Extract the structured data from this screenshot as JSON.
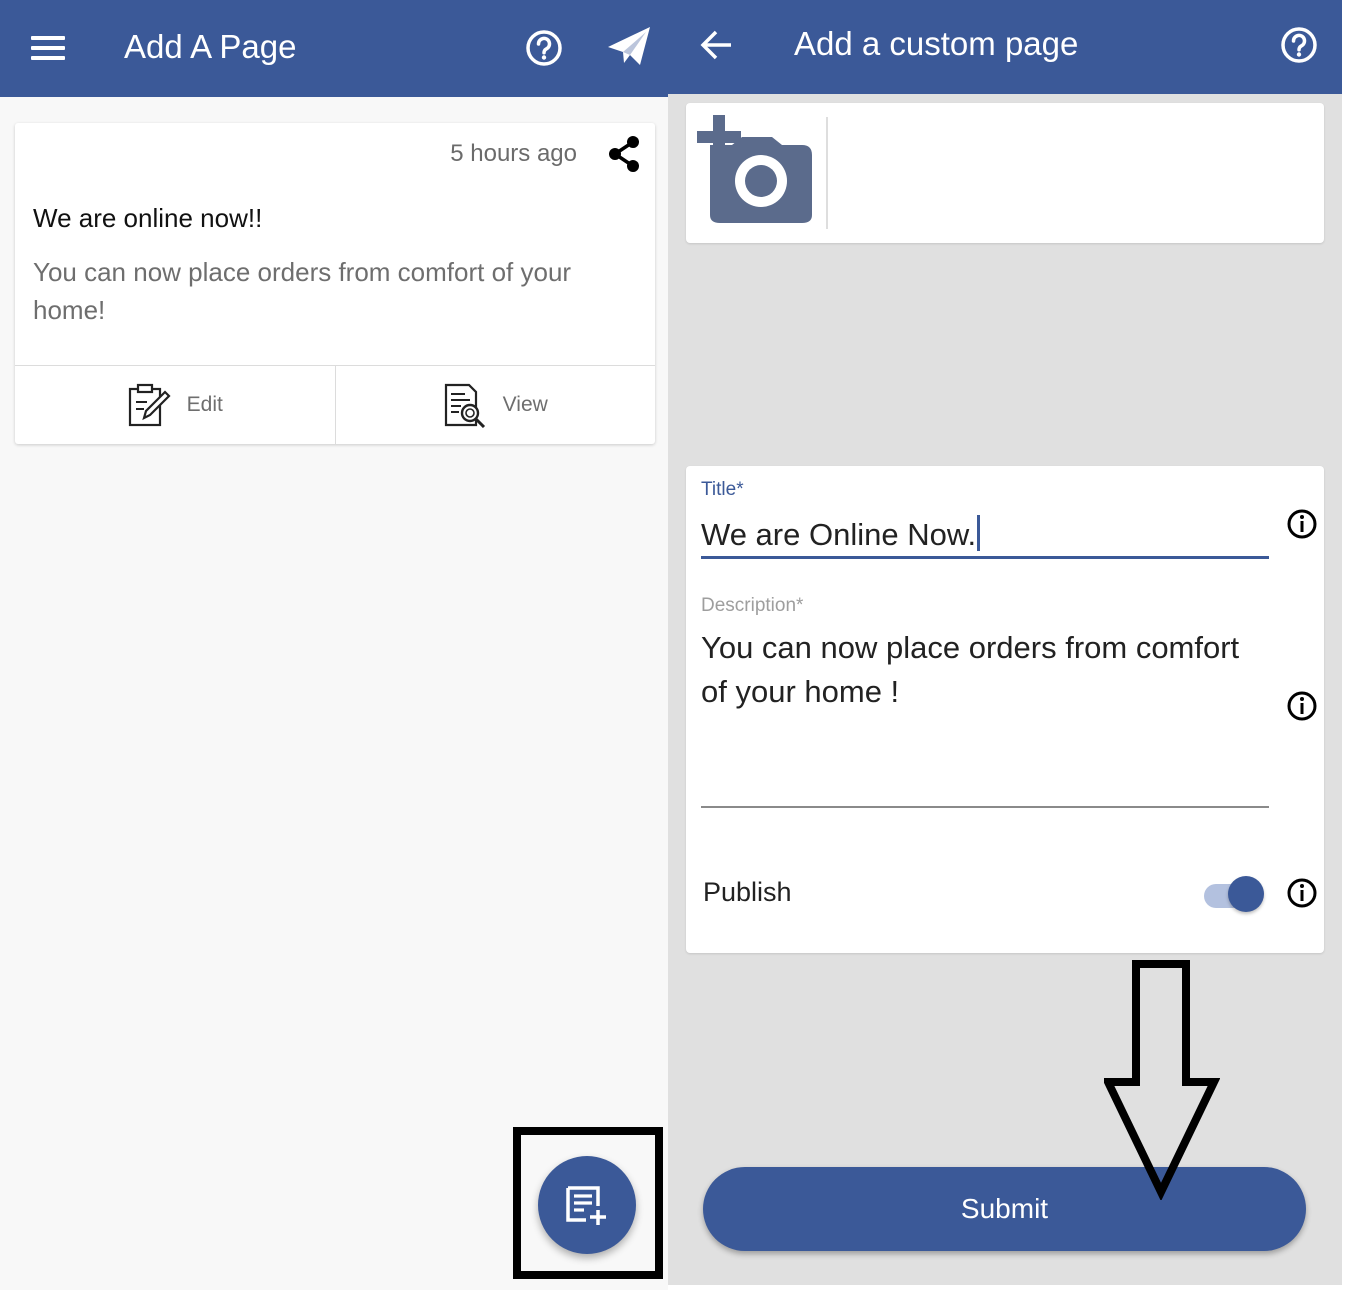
{
  "left_screen": {
    "appbar": {
      "title": "Add A Page",
      "icons": [
        "menu-icon",
        "help-icon",
        "send-icon"
      ]
    },
    "post_card": {
      "time": "5 hours ago",
      "title": "We are online now!!",
      "description": "You can now place orders from comfort of your home!",
      "actions": {
        "edit_label": "Edit",
        "view_label": "View"
      }
    },
    "fab": {
      "icon": "add-note-icon",
      "highlighted": true
    }
  },
  "right_screen": {
    "appbar": {
      "title": "Add a custom page",
      "icons": [
        "back-arrow-icon",
        "help-icon"
      ]
    },
    "photo_upload": {
      "icon": "add-photo-icon"
    },
    "form": {
      "title_label": "Title*",
      "title_value": "We are Online Now.",
      "description_label": "Description*",
      "description_value": "You can now place orders from comfort of your home !",
      "publish_label": "Publish",
      "publish_on": true
    },
    "submit_label": "Submit"
  },
  "colors": {
    "primary": "#3b5998",
    "toggle_track": "#b3c1df",
    "left_background": "#f8f8f8",
    "right_background": "#e0e0e0"
  }
}
